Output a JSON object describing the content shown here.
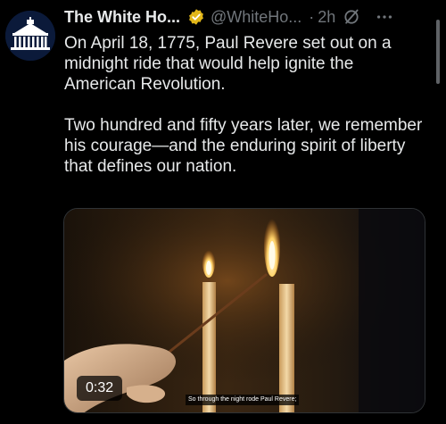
{
  "tweet": {
    "display_name": "The White Ho...",
    "handle": "@WhiteHo...",
    "separator": "·",
    "time": "2h",
    "paragraphs": [
      "On April 18, 1775, Paul Revere set out on a midnight ride that would help ignite the American Revolution.",
      "Two hundred and fifty years later, we remember his courage—and the enduring spirit of liberty that defines our nation."
    ]
  },
  "video": {
    "duration": "0:32",
    "caption": "So through the night rode Paul Revere;"
  },
  "icons": {
    "avatar": "white-house-logo",
    "verified": "verified-badge-icon",
    "grok": "grok-icon",
    "more": "more-icon"
  },
  "colors": {
    "background": "#000000",
    "text": "#e7e9ea",
    "secondary": "#71767b",
    "badge_gold": "#e2b719"
  }
}
